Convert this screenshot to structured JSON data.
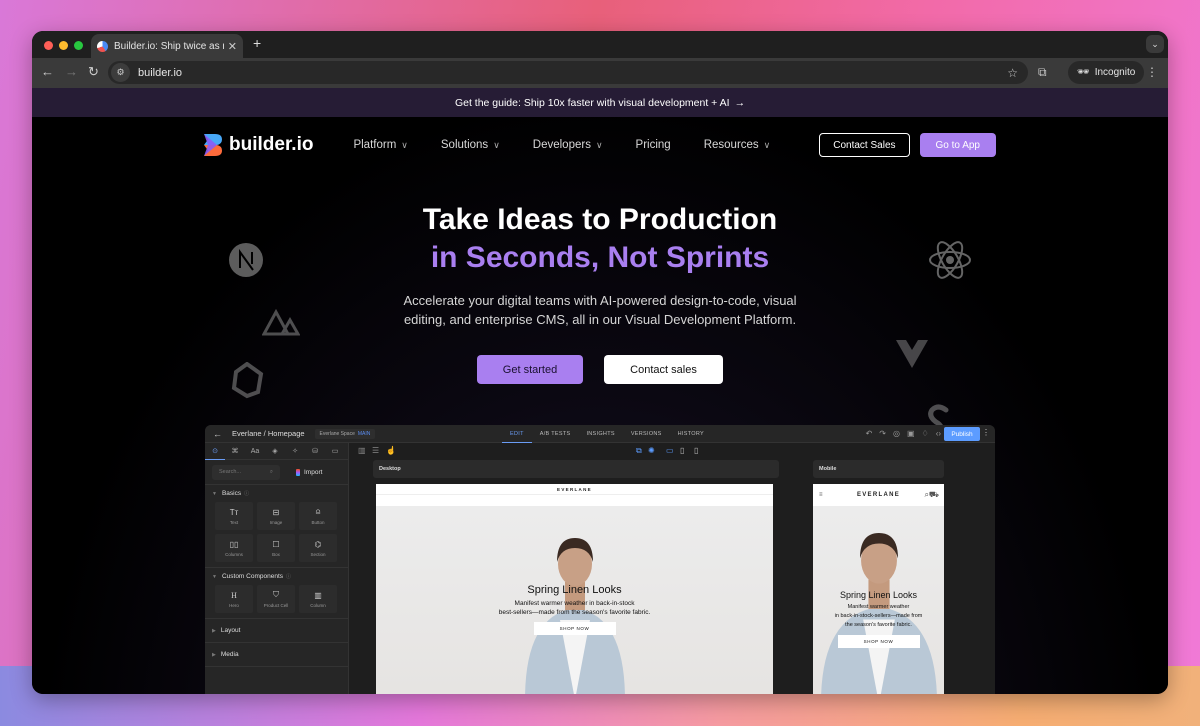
{
  "browser": {
    "tab_title": "Builder.io: Ship twice as much",
    "url": "builder.io",
    "profile_label": "Incognito",
    "icons": [
      "back-icon",
      "forward-icon",
      "reload-icon",
      "site-settings-icon",
      "bookmark-star-icon",
      "extensions-icon",
      "incognito-icon",
      "kebab-menu-icon",
      "new-tab-icon",
      "tab-close-icon",
      "tab-search-icon"
    ]
  },
  "promo": {
    "text": "Get the guide: Ship 10x faster with visual development + AI",
    "arrow": "→"
  },
  "nav": {
    "brand": "builder.io",
    "items": [
      {
        "label": "Platform",
        "has_dropdown": true
      },
      {
        "label": "Solutions",
        "has_dropdown": true
      },
      {
        "label": "Developers",
        "has_dropdown": true
      },
      {
        "label": "Pricing",
        "has_dropdown": false
      },
      {
        "label": "Resources",
        "has_dropdown": true
      }
    ],
    "contact_sales": "Contact Sales",
    "go_to_app": "Go to App"
  },
  "hero": {
    "title_line1": "Take Ideas to Production",
    "title_line2": "in Seconds, Not Sprints",
    "subtitle_line1": "Accelerate your digital teams with AI-powered design-to-code, visual",
    "subtitle_line2": "editing, and enterprise CMS, all in our Visual Development Platform.",
    "primary_cta": "Get started",
    "secondary_cta": "Contact sales",
    "framework_logos": [
      "nextjs-icon",
      "nuxt-icon",
      "qwik-icon",
      "react-icon",
      "vue-icon",
      "svelte-icon"
    ]
  },
  "editor": {
    "breadcrumb": "Everlane / Homepage",
    "space": "Everlane Space",
    "space_badge": "MAIN",
    "tabs": [
      {
        "label": "EDIT",
        "active": true
      },
      {
        "label": "A/B TESTS",
        "active": false
      },
      {
        "label": "INSIGHTS",
        "active": false
      },
      {
        "label": "VERSIONS",
        "active": false
      },
      {
        "label": "HISTORY",
        "active": false
      }
    ],
    "publish": "Publish",
    "search_placeholder": "Search...",
    "import": "Import",
    "sections": {
      "basics": {
        "title": "Basics",
        "items": [
          "Text",
          "Image",
          "Button",
          "Columns",
          "Box",
          "Section"
        ]
      },
      "custom": {
        "title": "Custom Components",
        "items": [
          "Hero",
          "Product Cell",
          "Column"
        ]
      },
      "collapsed": [
        "Layout",
        "Media"
      ]
    },
    "desktop_label": "Desktop",
    "mobile_label": "Mobile",
    "preview": {
      "brand": "EVERLANE",
      "headline": "Spring Linen Looks",
      "desc_desktop_1": "Manifest warmer weather in back-in-stock",
      "desc_desktop_2": "best-sellers—made from the season's favorite fabric.",
      "desc_mobile_1": "Manifest warmer weather",
      "desc_mobile_2": "in back-in-stock-sellers—made from",
      "desc_mobile_3": "the season's favorite fabric.",
      "cta": "SHOP NOW"
    }
  }
}
